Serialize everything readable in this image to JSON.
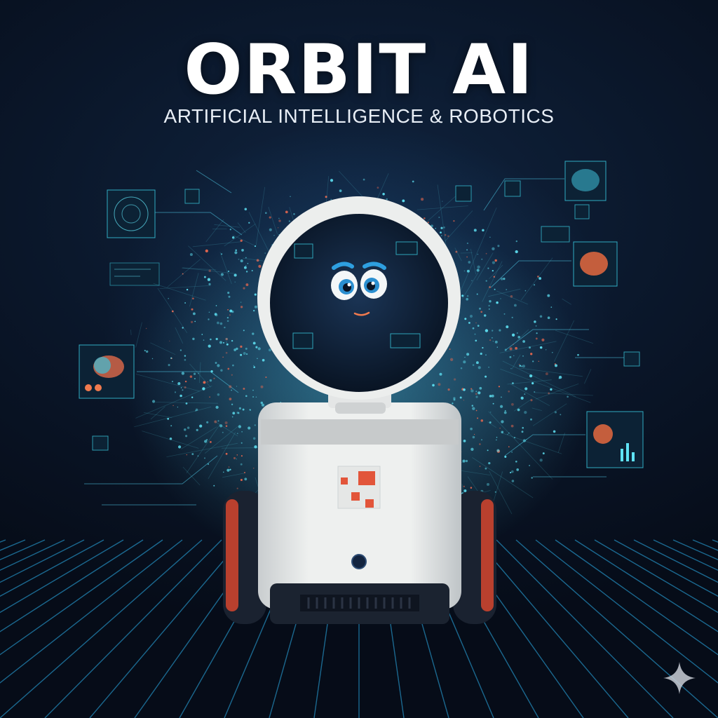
{
  "poster": {
    "title": "ORBIT AI",
    "subtitle": "ARTIFICIAL INTELLIGENCE & ROBOTICS"
  },
  "icons": {
    "watermark": "sparkle-icon"
  },
  "colors": {
    "background": "#07101f",
    "grid": "#2aa6e0",
    "particle_cyan": "#5fe3f5",
    "particle_coral": "#f26a4f",
    "robot_body": "#e9ebea",
    "accent_red": "#e2553a"
  }
}
